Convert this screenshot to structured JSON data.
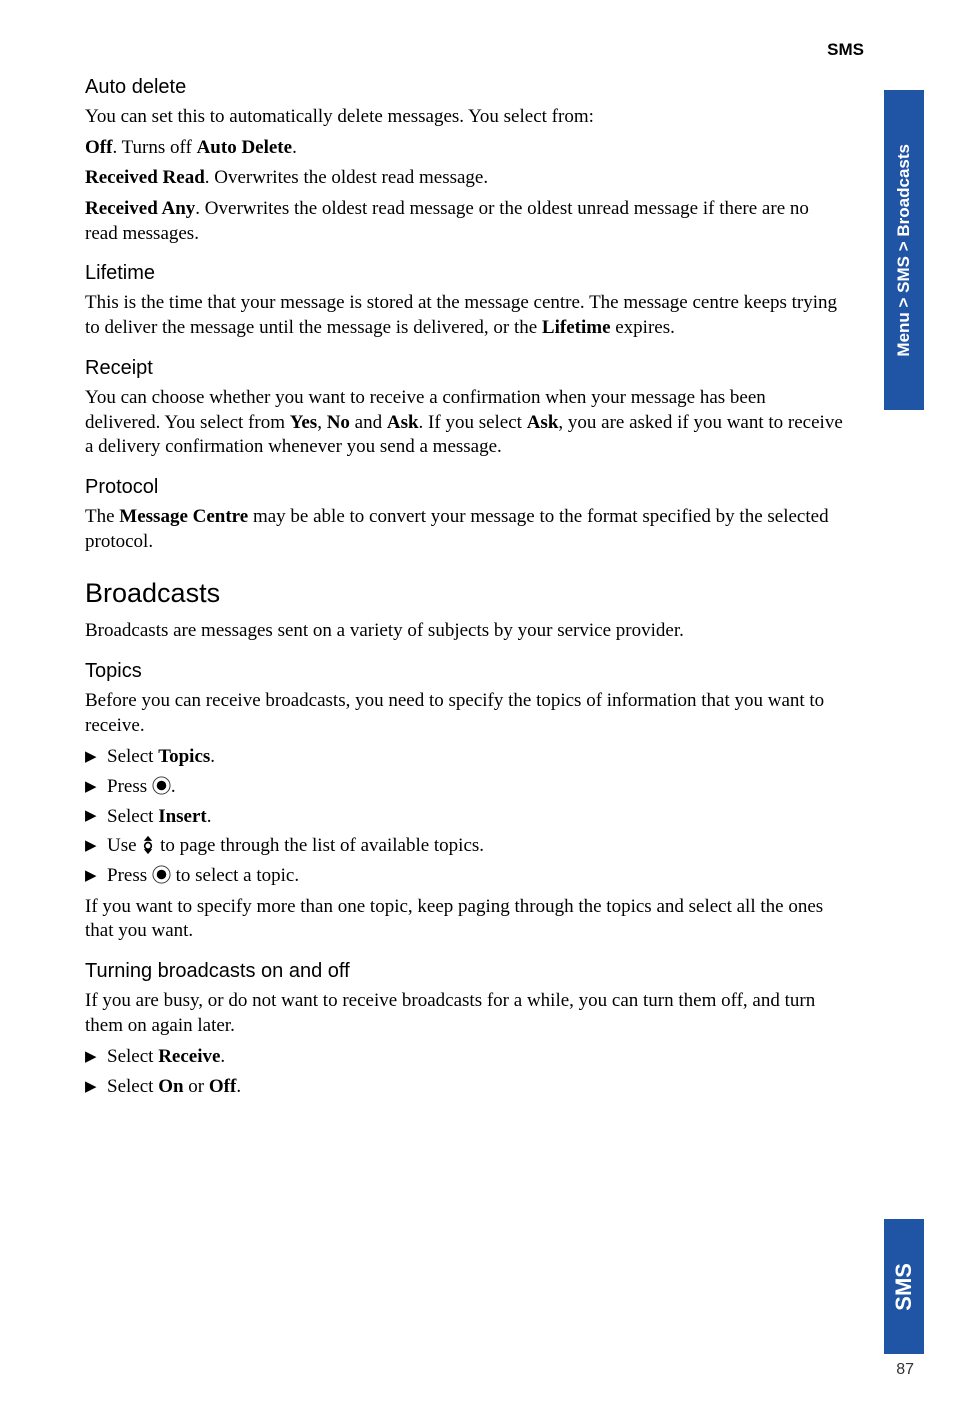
{
  "header": {
    "chapter": "SMS"
  },
  "sideTabs": {
    "top": "Menu > SMS > Broadcasts",
    "bottom": "SMS"
  },
  "pageNumber": "87",
  "sections": {
    "autoDelete": {
      "title": "Auto delete",
      "intro": "You can set this to automatically delete messages. You select from:",
      "off_b": "Off",
      "off_rest": ". Turns off ",
      "off_b2": "Auto Delete",
      "off_end": ".",
      "rr_b": "Received Read",
      "rr_rest": ". Overwrites the oldest read message.",
      "ra_b": "Received Any",
      "ra_rest": ". Overwrites the oldest read message or the oldest unread message if there are no read messages."
    },
    "lifetime": {
      "title": "Lifetime",
      "p_a": "This is the time that your message is stored at the message centre. The message centre keeps trying to deliver the message until the message is delivered, or the ",
      "p_b": "Lifetime",
      "p_c": " expires."
    },
    "receipt": {
      "title": "Receipt",
      "p_a": "You can choose whether you want to receive a confirmation when your message has been delivered. You select from ",
      "p_b": "Yes",
      "p_c": ", ",
      "p_d": "No",
      "p_e": " and ",
      "p_f": "Ask",
      "p_g": ". If you select ",
      "p_h": "Ask",
      "p_i": ", you are asked if you want to receive a delivery confirmation whenever you send a message."
    },
    "protocol": {
      "title": "Protocol",
      "p_a": "The ",
      "p_b": "Message Centre",
      "p_c": " may be able to convert your message to the format specified by the selected protocol."
    },
    "broadcasts": {
      "title": "Broadcasts",
      "intro": "Broadcasts are messages sent on a variety of subjects by your service provider."
    },
    "topics": {
      "title": "Topics",
      "intro": "Before you can receive broadcasts, you need to specify the topics of information that you want to receive.",
      "s1_a": "Select ",
      "s1_b": "Topics",
      "s1_c": ".",
      "s2_a": "Press ",
      "s2_b": ".",
      "s3_a": "Select ",
      "s3_b": "Insert",
      "s3_c": ".",
      "s4_a": "Use ",
      "s4_b": " to page through the list of available topics.",
      "s5_a": "Press ",
      "s5_b": " to select a topic.",
      "outro": "If you want to specify more than one topic, keep paging through the topics and select all the ones that you want."
    },
    "turning": {
      "title": "Turning broadcasts on and off",
      "intro": "If you are busy, or do not want to receive broadcasts for a while, you can turn them off, and turn them on again later.",
      "s1_a": "Select ",
      "s1_b": "Receive",
      "s1_c": ".",
      "s2_a": "Select ",
      "s2_b": "On",
      "s2_c": " or ",
      "s2_d": "Off",
      "s2_e": "."
    }
  }
}
